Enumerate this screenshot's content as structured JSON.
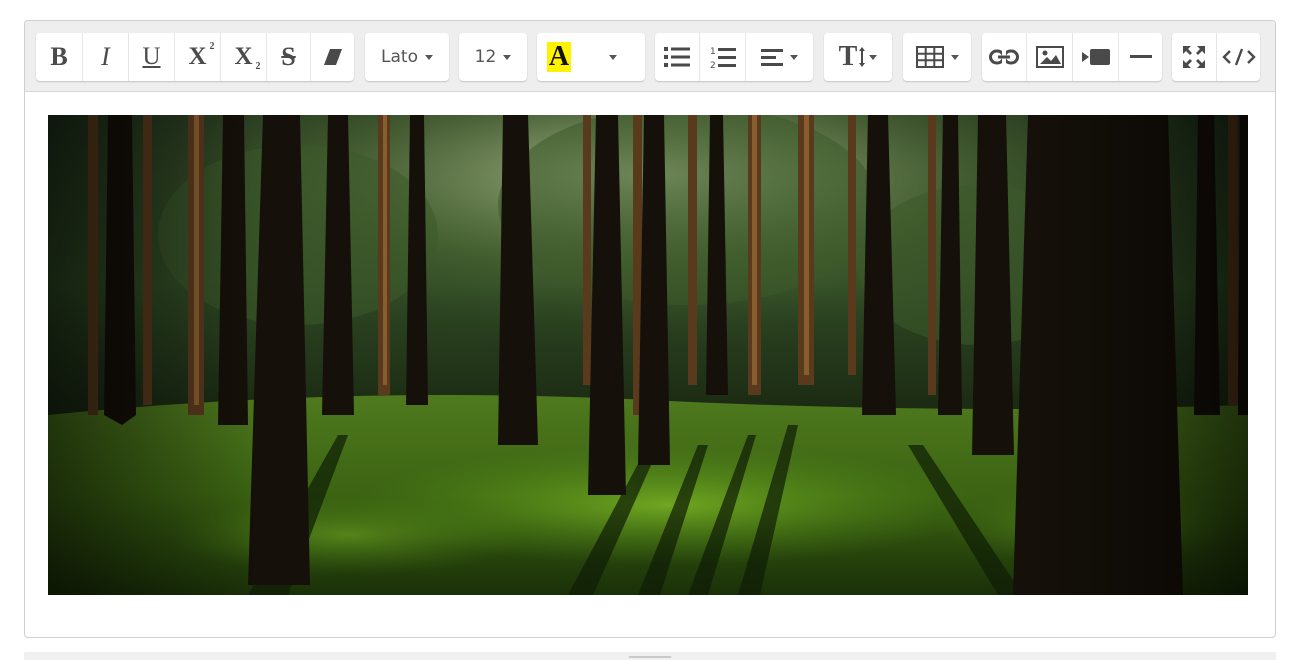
{
  "toolbar": {
    "bold_label": "B",
    "italic_label": "I",
    "underline_label": "U",
    "superscript_label": "X",
    "superscript_mark": "2",
    "subscript_label": "X",
    "subscript_mark": "2",
    "strikethrough_label": "S",
    "font_family": "Lato",
    "font_size": "12",
    "text_color_label": "A",
    "highlight_color": "#fff200",
    "line_height_label": "T",
    "icons": [
      "bold-icon",
      "italic-icon",
      "underline-icon",
      "superscript-icon",
      "subscript-icon",
      "strikethrough-icon",
      "eraser-icon",
      "text-color-icon",
      "bullet-list-icon",
      "numbered-list-icon",
      "align-icon",
      "line-height-icon",
      "table-icon",
      "link-icon",
      "image-icon",
      "video-icon",
      "horizontal-rule-icon",
      "fullscreen-icon",
      "code-view-icon"
    ]
  },
  "editor": {
    "image_icon": "forest-photo"
  }
}
